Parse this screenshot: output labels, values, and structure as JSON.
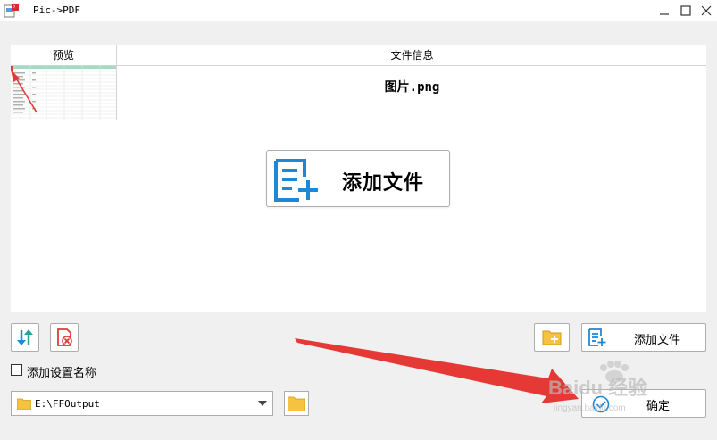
{
  "window": {
    "title": "Pic->PDF",
    "controls": [
      "minimize-icon",
      "maximize-icon",
      "close-icon"
    ]
  },
  "table": {
    "columns": [
      "预览",
      "文件信息"
    ],
    "rows": [
      {
        "file_name": "图片.png"
      }
    ]
  },
  "center_button": {
    "label": "添加文件",
    "icon": "add-file-icon"
  },
  "toolbar": {
    "sort_icon": "sort-icon",
    "remove_icon": "remove-file-icon",
    "add_folder_icon": "add-folder-icon",
    "add_file_label": "添加文件"
  },
  "options": {
    "add_name_label": "添加设置名称",
    "add_name_checked": false
  },
  "output": {
    "path": "E:\\FFOutput"
  },
  "confirm": {
    "label": "确定"
  },
  "watermark": {
    "line1": "Baidu 经验",
    "line2": "jingyan.baidu.com"
  },
  "colors": {
    "accent_blue": "#1e88d8",
    "folder_yellow": "#f5c242",
    "annotation_red": "#e53935"
  }
}
